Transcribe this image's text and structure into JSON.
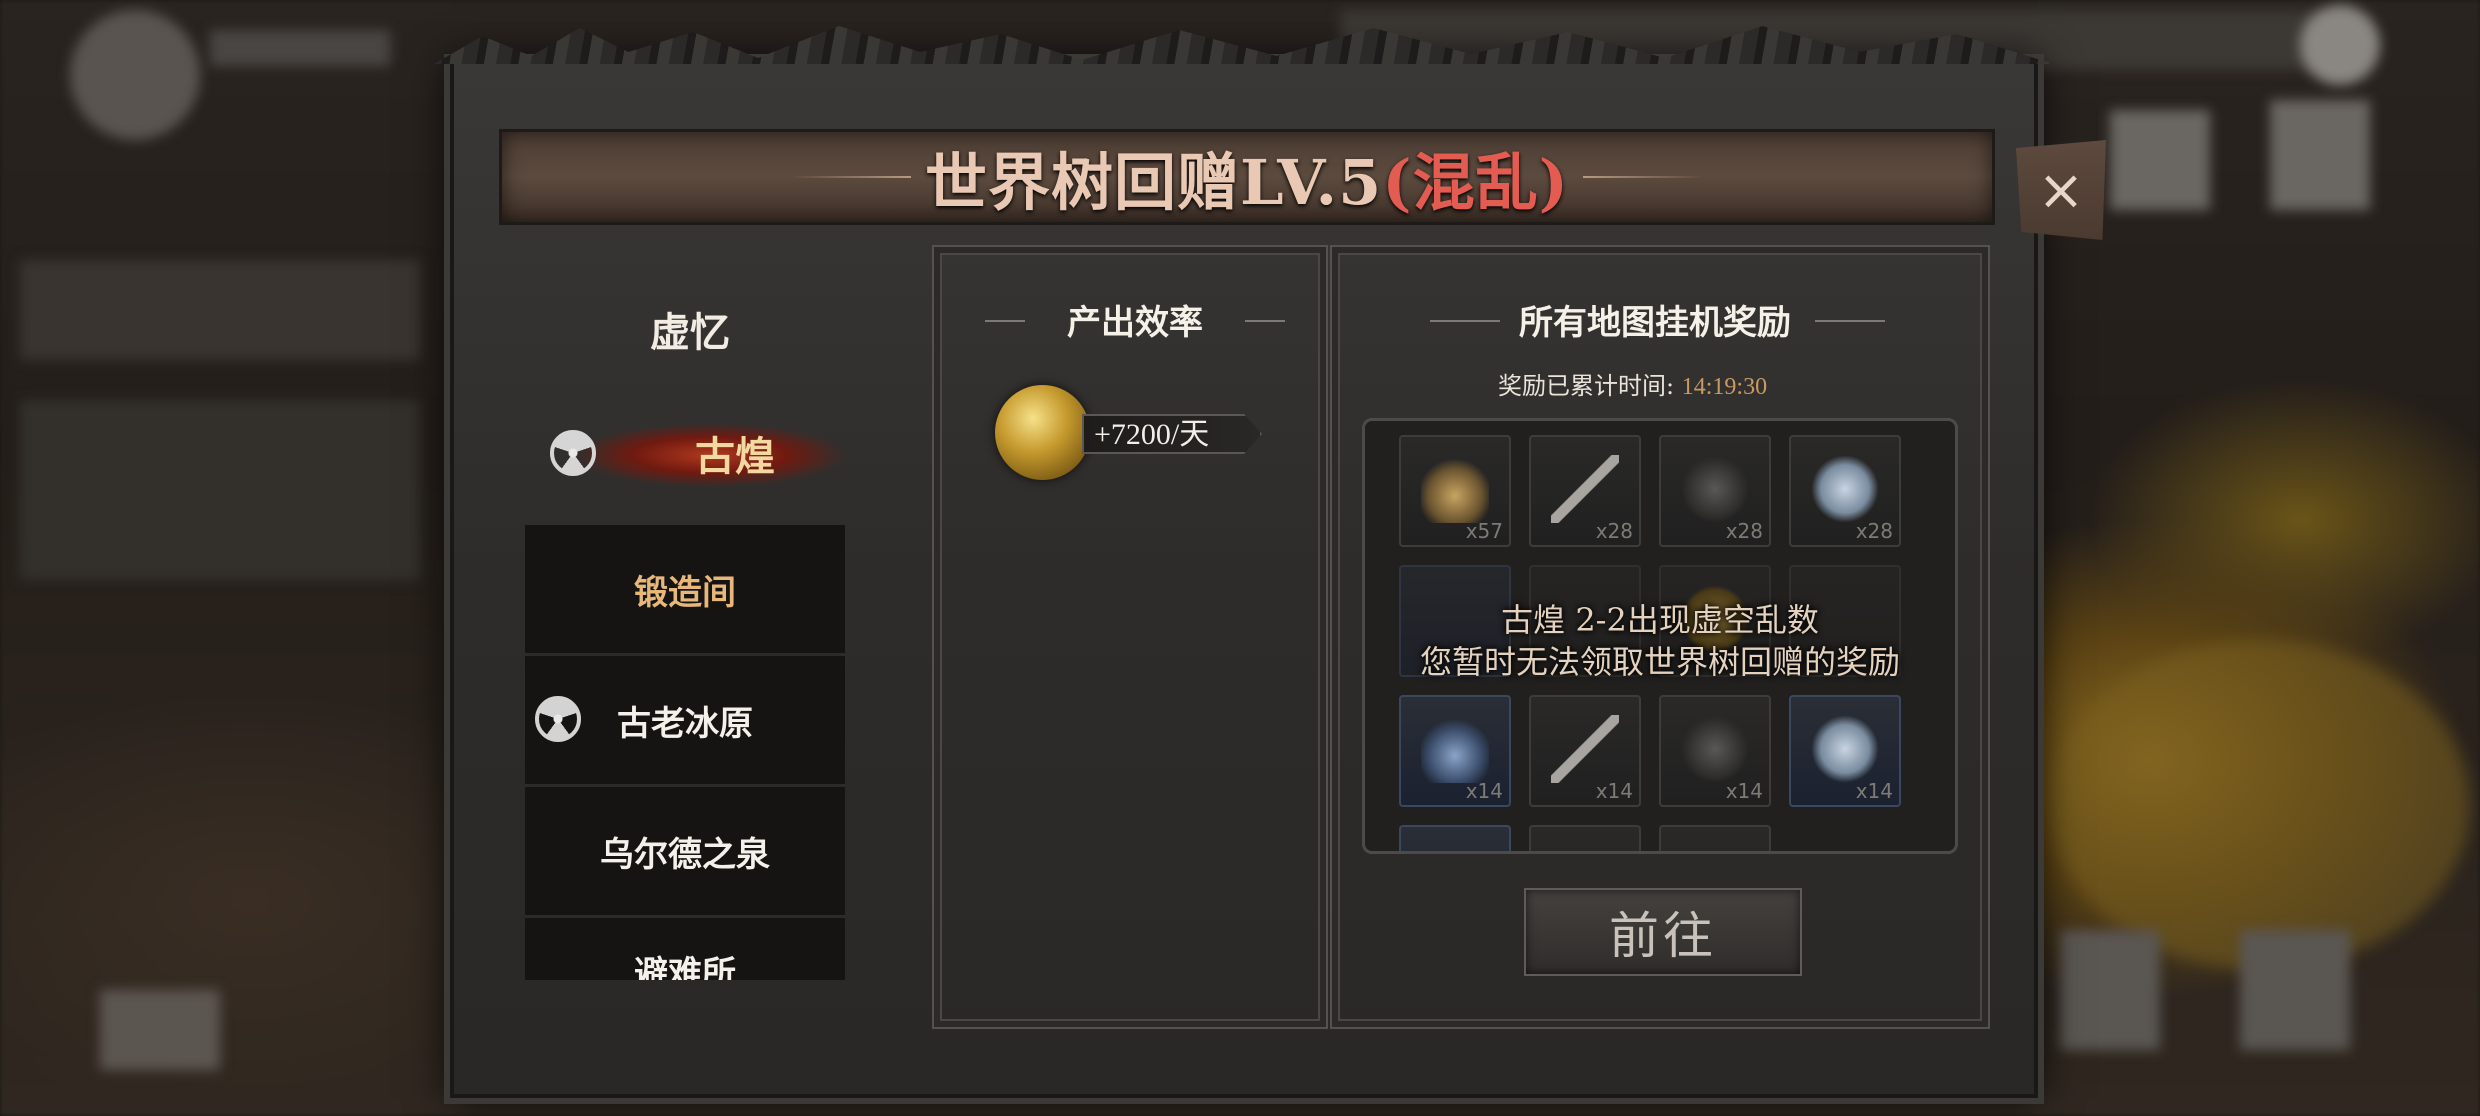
{
  "title": {
    "main": "世界树回赠LV.5",
    "chaos": "(混乱)"
  },
  "close": {
    "icon": "×"
  },
  "regions": {
    "header": "虚忆",
    "selected": "古煌",
    "sub_items": [
      {
        "label": "锻造间",
        "active": true
      },
      {
        "label": "古老冰原",
        "has_icon": true
      },
      {
        "label": "乌尔德之泉"
      },
      {
        "label": "避难所"
      }
    ]
  },
  "output": {
    "title": "产出效率",
    "rate": "+7200/天"
  },
  "rewards": {
    "title": "所有地图挂机奖励",
    "timer_label": "奖励已累计时间:",
    "timer_value": "14:19:30",
    "row1_counts": [
      "x57",
      "x28",
      "x28",
      "x28"
    ],
    "row3_counts": [
      "x14",
      "x14",
      "x14",
      "x14"
    ],
    "message_line1": "古煌 2-2出现虚空乱数",
    "message_line2": "您暂时无法领取世界树回赠的奖励",
    "goto_label": "前往"
  },
  "colors": {
    "accent_gold": "#e7b87a",
    "chaos_red": "#e25c52",
    "timer_gold": "#c89a62"
  }
}
